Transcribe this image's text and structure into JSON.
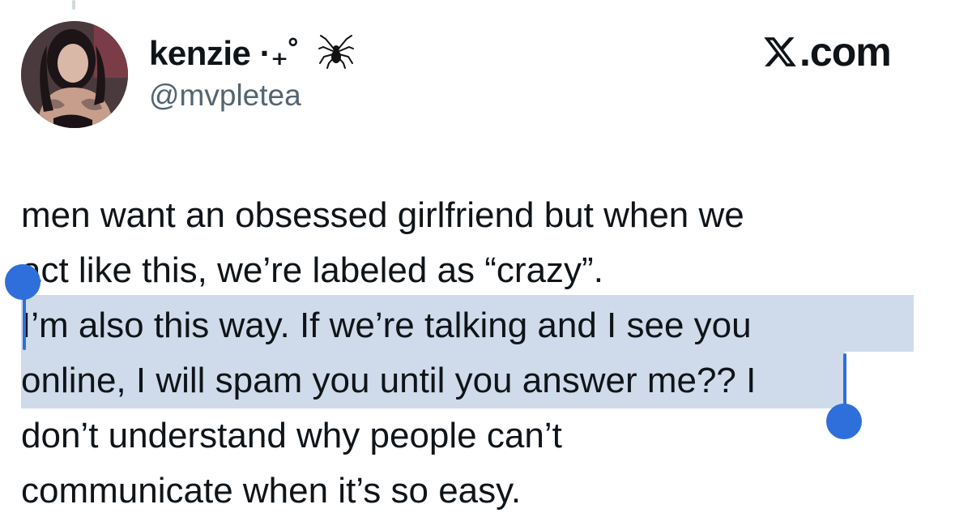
{
  "author": {
    "display_name": "kenzie ·₊˚",
    "display_name_emoji": "spider-icon",
    "handle": "@mvpletea",
    "avatar": "avatar"
  },
  "site_label": {
    "logo": "x-logo-icon",
    "text": ".com"
  },
  "tweet": {
    "lines": [
      "men want an obsessed girlfriend but when we",
      "act like this, we’re labeled as “crazy”.",
      "I’m also this way. If we’re talking and I see you",
      "online, I will spam you until you answer me?? I",
      "don’t understand why people can’t",
      "communicate when it’s so easy."
    ]
  },
  "selection": {
    "highlight_color": "#cfdbea",
    "handle_color": "#2f6fdb"
  }
}
